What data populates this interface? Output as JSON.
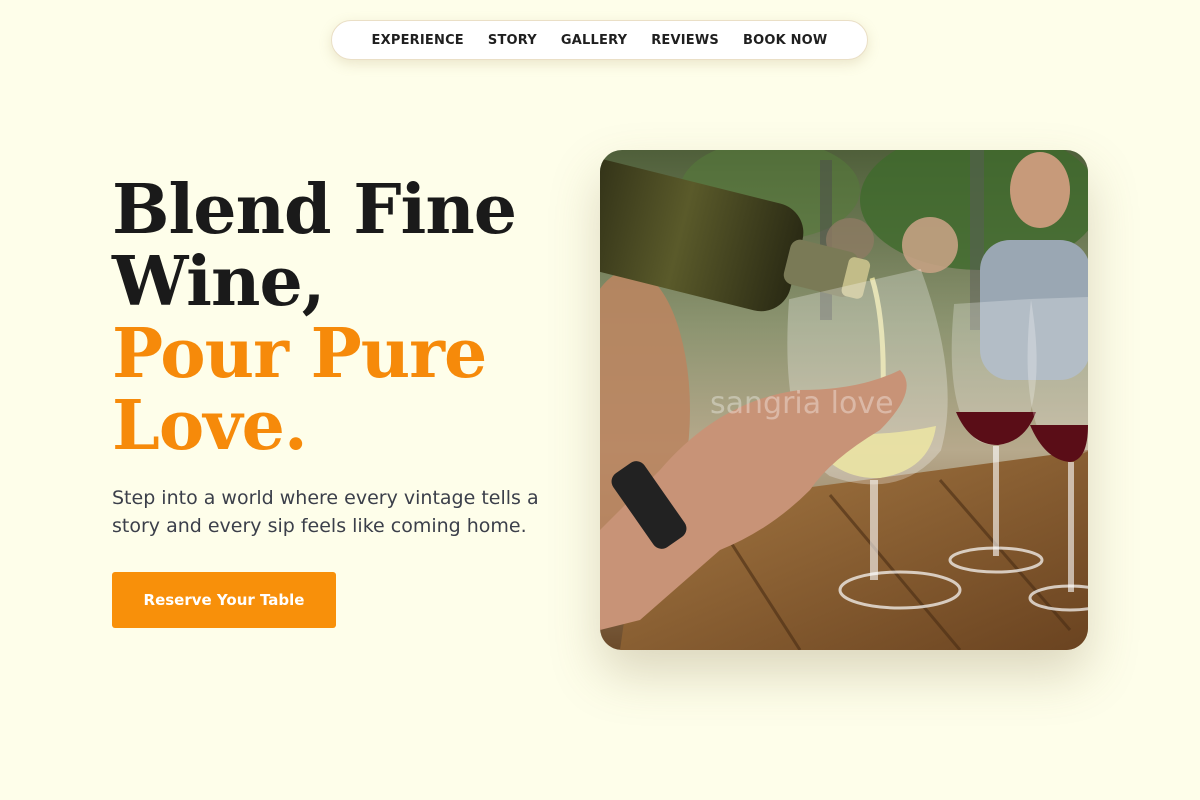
{
  "nav": {
    "items": [
      "EXPERIENCE",
      "STORY",
      "GALLERY",
      "REVIEWS",
      "BOOK NOW"
    ]
  },
  "hero": {
    "headline_line1": "Blend Fine",
    "headline_line2": "Wine,",
    "headline_line3": "Pour Pure",
    "headline_line4": "Love.",
    "subtext": "Step into a world where every vintage tells a story and every sip feels like coming home.",
    "cta_label": "Reserve Your Table",
    "image_watermark": "sangria love"
  },
  "colors": {
    "background": "#fefeea",
    "accent": "#f68a0a",
    "text_dark": "#1a1a1a"
  }
}
